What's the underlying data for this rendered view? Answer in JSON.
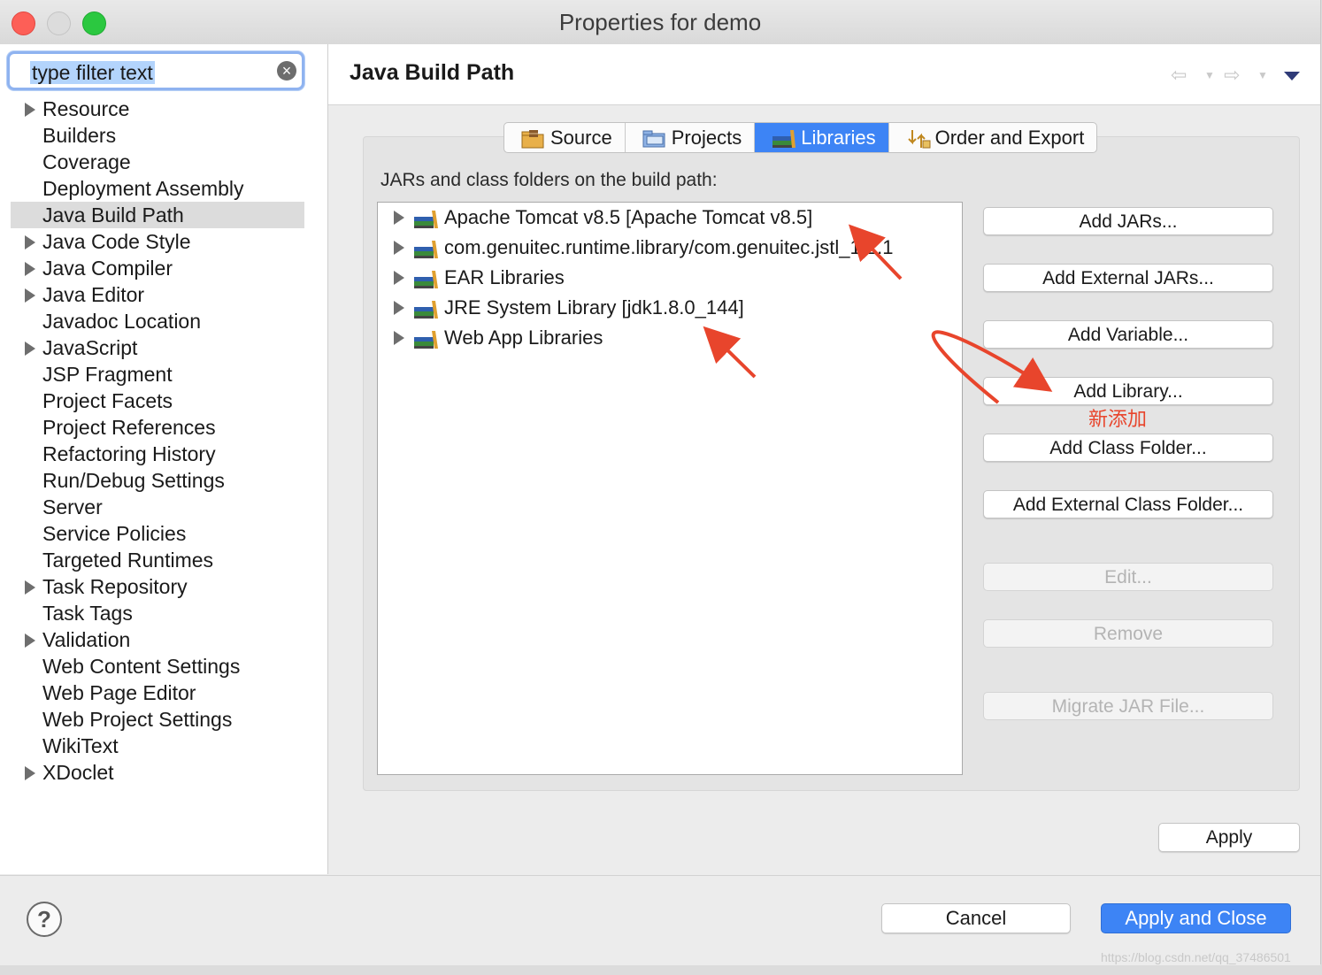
{
  "window": {
    "title": "Properties for demo"
  },
  "filter": {
    "text": "type filter text"
  },
  "sidebar": {
    "items": [
      {
        "label": "Resource",
        "expandable": true
      },
      {
        "label": "Builders",
        "expandable": false
      },
      {
        "label": "Coverage",
        "expandable": false
      },
      {
        "label": "Deployment Assembly",
        "expandable": false
      },
      {
        "label": "Java Build Path",
        "expandable": false,
        "selected": true
      },
      {
        "label": "Java Code Style",
        "expandable": true
      },
      {
        "label": "Java Compiler",
        "expandable": true
      },
      {
        "label": "Java Editor",
        "expandable": true
      },
      {
        "label": "Javadoc Location",
        "expandable": false
      },
      {
        "label": "JavaScript",
        "expandable": true
      },
      {
        "label": "JSP Fragment",
        "expandable": false
      },
      {
        "label": "Project Facets",
        "expandable": false
      },
      {
        "label": "Project References",
        "expandable": false
      },
      {
        "label": "Refactoring History",
        "expandable": false
      },
      {
        "label": "Run/Debug Settings",
        "expandable": false
      },
      {
        "label": "Server",
        "expandable": false
      },
      {
        "label": "Service Policies",
        "expandable": false
      },
      {
        "label": "Targeted Runtimes",
        "expandable": false
      },
      {
        "label": "Task Repository",
        "expandable": true
      },
      {
        "label": "Task Tags",
        "expandable": false
      },
      {
        "label": "Validation",
        "expandable": true
      },
      {
        "label": "Web Content Settings",
        "expandable": false
      },
      {
        "label": "Web Page Editor",
        "expandable": false
      },
      {
        "label": "Web Project Settings",
        "expandable": false
      },
      {
        "label": "WikiText",
        "expandable": false
      },
      {
        "label": "XDoclet",
        "expandable": true
      }
    ]
  },
  "page": {
    "title": "Java Build Path",
    "nav": {
      "back_icon": "back-arrow-icon",
      "forward_icon": "forward-arrow-icon",
      "menu_icon": "view-menu-icon"
    }
  },
  "tabs": [
    {
      "label": "Source",
      "icon": "source-folder-icon",
      "active": false
    },
    {
      "label": "Projects",
      "icon": "projects-icon",
      "active": false
    },
    {
      "label": "Libraries",
      "icon": "libraries-icon",
      "active": true
    },
    {
      "label": "Order and Export",
      "icon": "order-export-icon",
      "active": false
    }
  ],
  "libraries": {
    "label": "JARs and class folders on the build path:",
    "items": [
      "Apache Tomcat v8.5 [Apache Tomcat v8.5]",
      "com.genuitec.runtime.library/com.genuitec.jstl_1.2.1",
      "EAR Libraries",
      "JRE System Library [jdk1.8.0_144]",
      "Web App Libraries"
    ]
  },
  "buttons": {
    "add_jars": "Add JARs...",
    "add_external_jars": "Add External JARs...",
    "add_variable": "Add Variable...",
    "add_library": "Add Library...",
    "add_class_folder": "Add Class Folder...",
    "add_external_class_folder": "Add External Class Folder...",
    "edit": "Edit...",
    "remove": "Remove",
    "migrate_jar": "Migrate JAR File...",
    "apply": "Apply",
    "cancel": "Cancel",
    "apply_and_close": "Apply and Close"
  },
  "annotation": {
    "text": "新添加",
    "color": "#e8452c"
  },
  "help": {
    "icon": "help-icon",
    "glyph": "?"
  },
  "watermark": {
    "text": "https://blog.csdn.net/qq_37486501"
  },
  "colors": {
    "accent": "#3d84f5",
    "annotation_red": "#e8452c"
  }
}
